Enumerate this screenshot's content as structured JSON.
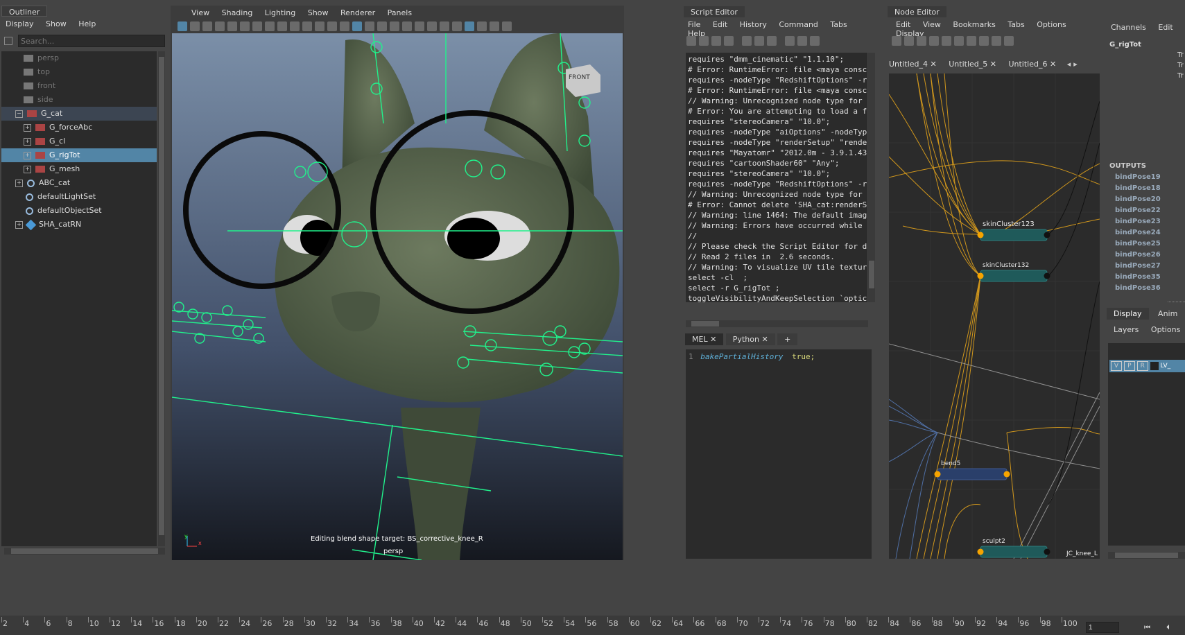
{
  "outliner": {
    "title": "Outliner",
    "menu": [
      "Display",
      "Show",
      "Help"
    ],
    "search_placeholder": "Search...",
    "items": [
      {
        "label": "persp",
        "dim": true
      },
      {
        "label": "top",
        "dim": true
      },
      {
        "label": "front",
        "dim": true
      },
      {
        "label": "side",
        "dim": true
      },
      {
        "label": "G_cat",
        "expanded": true
      },
      {
        "label": "G_forceAbc"
      },
      {
        "label": "G_cl"
      },
      {
        "label": "G_rigTot",
        "selected": true
      },
      {
        "label": "G_mesh"
      },
      {
        "label": "ABC_cat"
      },
      {
        "label": "defaultLightSet"
      },
      {
        "label": "defaultObjectSet"
      },
      {
        "label": "SHA_catRN"
      }
    ]
  },
  "viewport": {
    "menu": [
      "View",
      "Shading",
      "Lighting",
      "Show",
      "Renderer",
      "Panels"
    ],
    "hud_text": "Editing blend shape target: BS_corrective_knee_R",
    "camera_label": "persp",
    "viewcube_label": "FRONT",
    "axis_y": "y",
    "axis_x": "x"
  },
  "script_editor": {
    "title": "Script Editor",
    "menu": [
      "File",
      "Edit",
      "History",
      "Command",
      "Tabs",
      "Help"
    ],
    "history_lines": [
      "requires \"dmm_cinematic\" \"1.1.10\";",
      "# Error: RuntimeError: file <maya consc",
      "requires -nodeType \"RedshiftOptions\" -r",
      "# Error: RuntimeError: file <maya consc",
      "// Warning: Unrecognized node type for",
      "# Error: You are attempting to load a f",
      "requires \"stereoCamera\" \"10.0\";",
      "requires -nodeType \"aiOptions\" -nodeTyp",
      "requires -nodeType \"renderSetup\" \"rende",
      "requires \"Mayatomr\" \"2012.0m - 3.9.1.43",
      "requires \"cartoonShader60\" \"Any\";",
      "requires \"stereoCamera\" \"10.0\";",
      "requires -nodeType \"RedshiftOptions\" -r",
      "// Warning: Unrecognized node type for",
      "# Error: Cannot delete 'SHA_cat:renderS",
      "// Warning: line 1464: The default imag",
      "// Warning: Errors have occurred while",
      "//",
      "// Please check the Script Editor for d",
      "// Read 2 files in  2.6 seconds.",
      "// Warning: To visualize UV tile textur",
      "select -cl  ;",
      "select -r G_rigTot ;",
      "toggleVisibilityAndKeepSelection `optic"
    ],
    "tabs": [
      "MEL",
      "Python",
      "+"
    ],
    "input_line_number": "1",
    "input_keyword": "bakePartialHistory",
    "input_value": "true;"
  },
  "node_editor": {
    "title": "Node Editor",
    "menu": [
      "Edit",
      "View",
      "Bookmarks",
      "Tabs",
      "Options",
      "Display"
    ],
    "tabs": [
      "Untitled_4",
      "Untitled_5",
      "Untitled_6"
    ],
    "nodes": [
      {
        "label": "skinCluster123"
      },
      {
        "label": "skinCluster132"
      },
      {
        "label": "bend5"
      },
      {
        "label": "sculpt2"
      }
    ],
    "corner_label": "JC_knee_L"
  },
  "channel_box": {
    "menu": [
      "Channels",
      "Edit",
      "O"
    ],
    "object": "G_rigTot",
    "attr_prefix": [
      "Tr",
      "Tr",
      "Tr"
    ],
    "outputs_label": "OUTPUTS",
    "outputs": [
      "bindPose19",
      "bindPose18",
      "bindPose20",
      "bindPose22",
      "bindPose23",
      "bindPose24",
      "bindPose25",
      "bindPose26",
      "bindPose27",
      "bindPose35",
      "bindPose36"
    ],
    "bottom_tabs": [
      "Display",
      "Anim"
    ],
    "layer_menu": [
      "Layers",
      "Options"
    ],
    "layer_buttons": [
      "V",
      "P",
      "R"
    ],
    "layer_name": "LV_"
  },
  "timeline": {
    "ticks": [
      "2",
      "4",
      "6",
      "8",
      "10",
      "12",
      "14",
      "16",
      "18",
      "20",
      "22",
      "24",
      "26",
      "28",
      "30",
      "32",
      "34",
      "36",
      "38",
      "40",
      "42",
      "44",
      "46",
      "48",
      "50",
      "52",
      "54",
      "56",
      "58",
      "60",
      "62",
      "64",
      "66",
      "68",
      "70",
      "72",
      "74",
      "76",
      "78",
      "80",
      "82",
      "84",
      "86",
      "88",
      "90",
      "92",
      "94",
      "96",
      "98",
      "100"
    ],
    "current_frame": "1"
  },
  "colors": {
    "selected": "#5285a6",
    "rig_green": "#21f28c",
    "wire_orange": "#f6a400",
    "node_teal": "#1f5a5a",
    "node_blue": "#2a3f6a"
  }
}
